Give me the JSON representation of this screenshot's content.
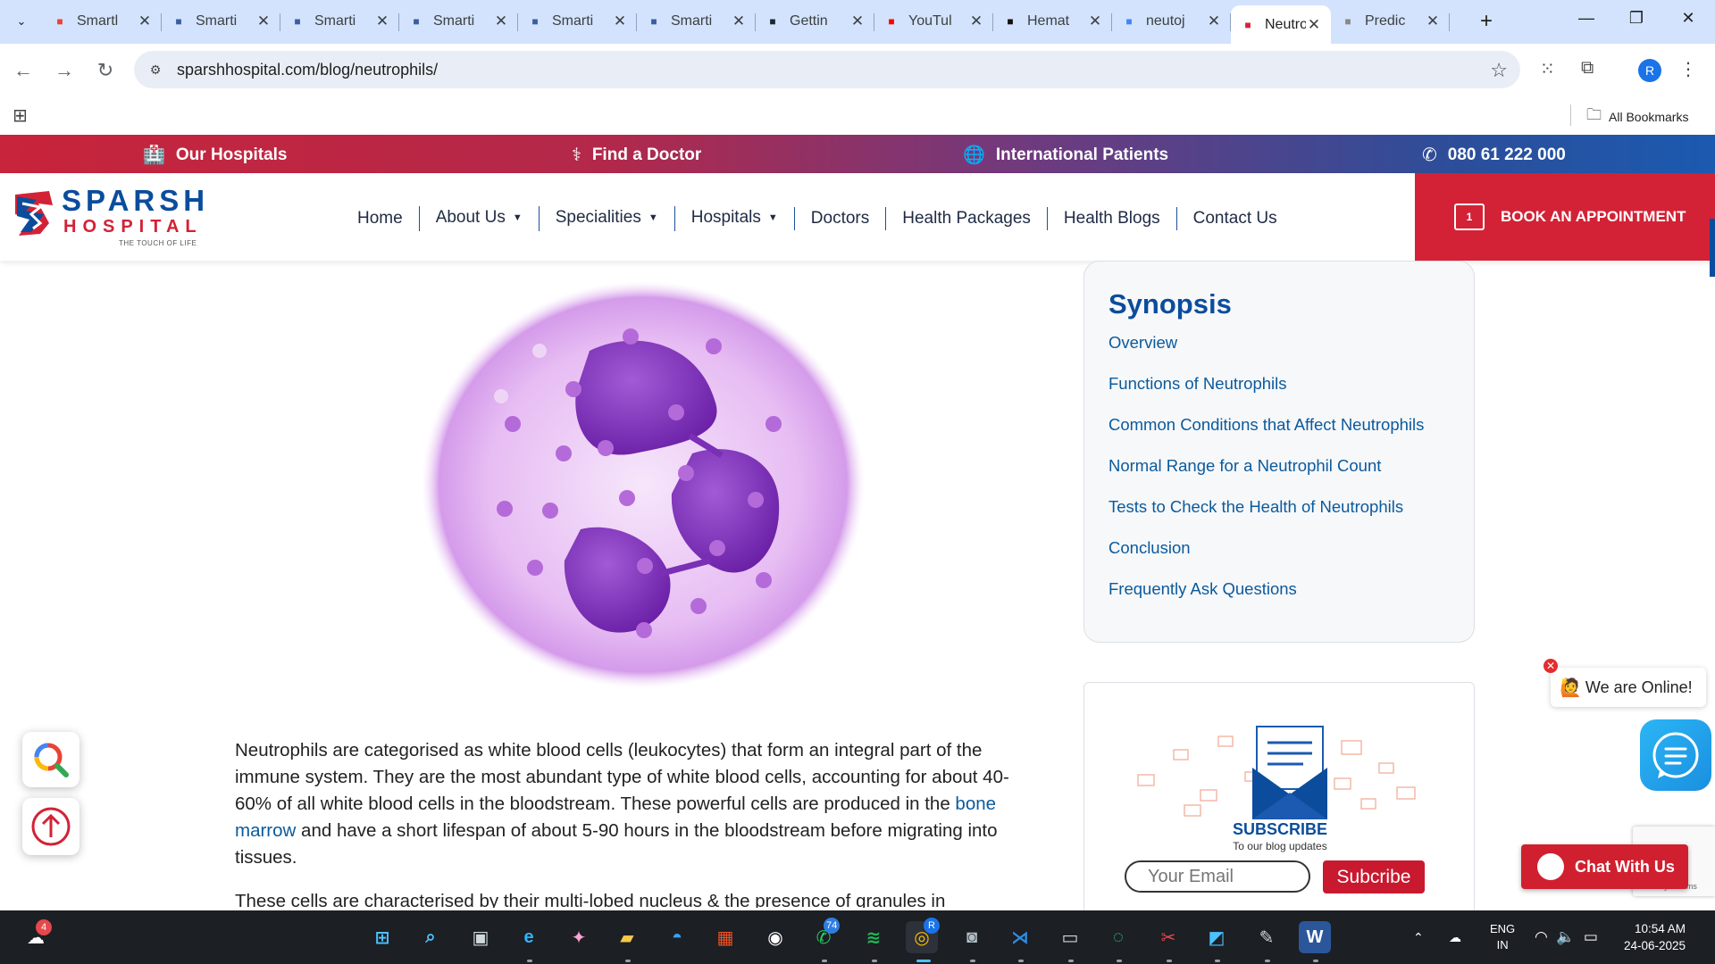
{
  "browser": {
    "tabs": [
      {
        "title": "Smartl",
        "icon": "gmail-icon",
        "color": "#ea4335"
      },
      {
        "title": "Smarti",
        "icon": "smartdraw-icon",
        "color": "#3b5f9e"
      },
      {
        "title": "Smarti",
        "icon": "smartdraw-icon",
        "color": "#3b5f9e"
      },
      {
        "title": "Smarti",
        "icon": "smartdraw-icon",
        "color": "#3b5f9e"
      },
      {
        "title": "Smarti",
        "icon": "smartdraw-icon",
        "color": "#3b5f9e"
      },
      {
        "title": "Smarti",
        "icon": "smartdraw-icon",
        "color": "#3b5f9e"
      },
      {
        "title": "Gettin",
        "icon": "yoast-icon",
        "color": "#1b2a2f"
      },
      {
        "title": "YouTul",
        "icon": "youtube-icon",
        "color": "#ff0000"
      },
      {
        "title": "Hemat",
        "icon": "openai-icon",
        "color": "#111111"
      },
      {
        "title": "neutoj",
        "icon": "google-icon",
        "color": "#4285f4"
      },
      {
        "title": "Neutro",
        "icon": "sparsh-icon",
        "color": "#d32236"
      },
      {
        "title": "Predic",
        "icon": "globe-icon",
        "color": "#888888"
      }
    ],
    "active_tab": 10,
    "url": "sparshhospital.com/blog/neutrophils/",
    "profile_initial": "R",
    "all_bookmarks": "All Bookmarks"
  },
  "site": {
    "topbar": {
      "our_hospitals": "Our Hospitals",
      "find_doctor": "Find a Doctor",
      "international": "International Patients",
      "phone": "080 61 222 000"
    },
    "logo": {
      "name": "SPARSH",
      "sub": "HOSPITAL",
      "tagline": "THE TOUCH OF LIFE"
    },
    "nav": {
      "home": "Home",
      "about": "About Us",
      "specialities": "Specialities",
      "hospitals": "Hospitals",
      "doctors": "Doctors",
      "packages": "Health Packages",
      "blogs": "Health Blogs",
      "contact": "Contact Us"
    },
    "book_label": "BOOK AN APPOINTMENT",
    "book_cal_day": "1"
  },
  "article": {
    "p1_a": "Neutrophils are categorised as white blood cells (leukocytes) that form an integral part of the immune system. They are the most abundant type of white blood cells, accounting for about 40-60% of all white blood cells in the bloodstream. These powerful cells are produced in the ",
    "p1_link": "bone marrow",
    "p1_b": " and have a short lifespan of about 5-90 hours in the bloodstream before migrating into tissues.",
    "p2": "These cells are characterised by their multi-lobed nucleus & the presence of granules in"
  },
  "synopsis": {
    "title": "Synopsis",
    "items": [
      "Overview",
      "Functions of Neutrophils",
      "Common Conditions that Affect Neutrophils",
      "Normal Range for a Neutrophil Count",
      "Tests to Check the Health of Neutrophils",
      "Conclusion",
      "Frequently Ask Questions"
    ]
  },
  "subscribe": {
    "title": "SUBSCRIBE",
    "subtitle": "To our blog updates",
    "email_placeholder": "Your Email",
    "button": "Subcribe"
  },
  "widgets": {
    "online": "We are Online!",
    "chat": "Chat With Us",
    "recaptcha": "Privacy - Terms"
  },
  "taskbar": {
    "weather_badge": "4",
    "whatsapp_badge": "74",
    "chrome_badge": "R",
    "lang_1": "ENG",
    "lang_2": "IN",
    "time": "10:54 AM",
    "date": "24-06-2025"
  }
}
